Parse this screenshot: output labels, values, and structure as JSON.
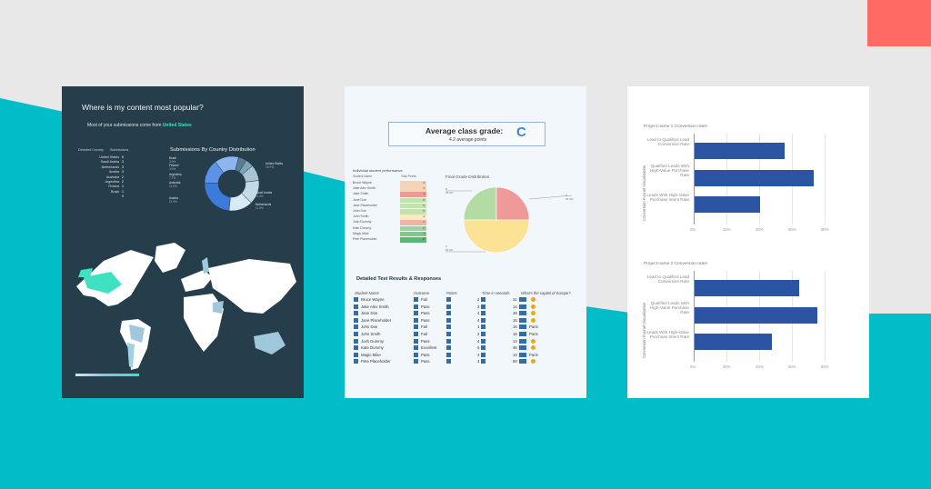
{
  "colors": {
    "teal": "#00bdc7",
    "coral": "#ff6b63",
    "navy": "#263d4b",
    "mint": "#45e0c5",
    "blue": "#2b54a3"
  },
  "panel1": {
    "title": "Where is my content most popular?",
    "subtitle_prefix": "Most of your submissions come from",
    "subtitle_country": "United States",
    "table_headers": [
      "Detected Country",
      "Submissions"
    ],
    "countries": [
      {
        "name": "United States",
        "count": "5"
      },
      {
        "name": "Saudi Arabia",
        "count": "3"
      },
      {
        "name": "Netherlands",
        "count": "3"
      },
      {
        "name": "Austria",
        "count": "3"
      },
      {
        "name": "Australia",
        "count": "2"
      },
      {
        "name": "Argentina",
        "count": "2"
      },
      {
        "name": "Finland",
        "count": "1"
      },
      {
        "name": "Brazil",
        "count": "1"
      },
      {
        "name": "",
        "count": "0"
      }
    ],
    "chart_title": "Submissions By Country Distribution",
    "donut_labels": [
      {
        "name": "Brazil",
        "pct": "3.9%"
      },
      {
        "name": "Finland",
        "pct": "3.9%"
      },
      {
        "name": "Argentina",
        "pct": "7.7%"
      },
      {
        "name": "Australia",
        "pct": "11.5%"
      },
      {
        "name": "Austria",
        "pct": "11.5%"
      },
      {
        "name": "United States",
        "pct": "19.2%"
      },
      {
        "name": "Saudi Arabia",
        "pct": "11.5%"
      },
      {
        "name": "Netherlands",
        "pct": "11.5%"
      }
    ]
  },
  "panel2": {
    "grade_title": "Average class grade:",
    "grade_sub": "4.2  average points",
    "grade_letter": "C",
    "individual_title": "Individual student performance",
    "ind_headers": [
      "Student Name",
      "Total Points"
    ],
    "students": [
      {
        "name": "Bruce Wayne",
        "points": "3",
        "color": "#f5d3b6"
      },
      {
        "name": "Jake Alex Smith",
        "points": "3",
        "color": "#f5d3b6"
      },
      {
        "name": "Jake Smith",
        "points": "1",
        "color": "#ee9a94"
      },
      {
        "name": "Jane Doe",
        "points": "5",
        "color": "#c3e2b0"
      },
      {
        "name": "Jane Placeholder",
        "points": "5",
        "color": "#c3e2b0"
      },
      {
        "name": "John Doe",
        "points": "5",
        "color": "#c3e2b0"
      },
      {
        "name": "John Smith",
        "points": "4",
        "color": "#fbe9c2"
      },
      {
        "name": "Josh Dummy",
        "points": "2",
        "color": "#f0b5a8"
      },
      {
        "name": "Kate Dummy",
        "points": "6",
        "color": "#9cd49a"
      },
      {
        "name": "Magic Mike",
        "points": "7",
        "color": "#7ec98a"
      },
      {
        "name": "Pete Placeholder",
        "points": "8",
        "color": "#5bb873"
      }
    ],
    "final_title": "Final Grade Distribution",
    "pie_labels": [
      {
        "label": "B",
        "pct": "25.0%"
      },
      {
        "label": "C",
        "pct": "50.0%"
      },
      {
        "label": "D",
        "pct": "25.0%"
      }
    ],
    "detailed_title": "Detailed Test Results & Responses",
    "detail_headers": [
      "Student Name",
      "Outcome",
      "Points",
      "Time in seconds",
      "What's the capital of Europe?"
    ],
    "results": [
      {
        "name": "Bruce Wayne",
        "outcome": "Fail",
        "points": "2",
        "time": "31",
        "answer": ""
      },
      {
        "name": "Jake Alex Smith",
        "outcome": "Pass",
        "points": "3",
        "time": "14",
        "answer": ""
      },
      {
        "name": "Jane Doe",
        "outcome": "Pass",
        "points": "4",
        "time": "49",
        "answer": ""
      },
      {
        "name": "Jane Placeholder",
        "outcome": "Pass",
        "points": "4",
        "time": "15",
        "answer": ""
      },
      {
        "name": "John Doe",
        "outcome": "Fail",
        "points": "1",
        "time": "16",
        "answer": "Paris"
      },
      {
        "name": "John Smith",
        "outcome": "Fail",
        "points": "2",
        "time": "15",
        "answer": "Paris"
      },
      {
        "name": "Josh Dummy",
        "outcome": "Pass",
        "points": "4",
        "time": "14",
        "answer": ""
      },
      {
        "name": "Kate Dummy",
        "outcome": "Excellent",
        "points": "5",
        "time": "46",
        "answer": ""
      },
      {
        "name": "Magic Mike",
        "outcome": "Pass",
        "points": "4",
        "time": "13",
        "answer": "Paris"
      },
      {
        "name": "Pete Placeholder",
        "outcome": "Pass",
        "points": "4",
        "time": "50",
        "answer": ""
      }
    ]
  },
  "panel3": {
    "y_axis_label": "Conversion Funnel Visualisation",
    "ticks": [
      "0%",
      "20%",
      "40%",
      "60%",
      "80%"
    ]
  },
  "chart_data": [
    {
      "type": "pie",
      "title": "Submissions By Country Distribution",
      "categories": [
        "Brazil",
        "Finland",
        "Argentina",
        "Australia",
        "Austria",
        "United States",
        "Saudi Arabia",
        "Netherlands"
      ],
      "values": [
        3.9,
        3.9,
        7.7,
        11.5,
        11.5,
        19.2,
        11.5,
        11.5
      ]
    },
    {
      "type": "pie",
      "title": "Final Grade Distribution",
      "categories": [
        "B",
        "C",
        "D"
      ],
      "values": [
        25.0,
        50.0,
        25.0
      ]
    },
    {
      "type": "bar",
      "orientation": "horizontal",
      "title": "Project name 1 Conversion rates",
      "ylabel": "Conversion Funnel Visualisation",
      "categories": [
        "Lead to Qualified Lead Conversion Rate",
        "Qualified Leads With High-Value Purchase Rate",
        "Leads With High-Value Purchase Intent Rate"
      ],
      "values": [
        55,
        73,
        40
      ],
      "xlim": [
        0,
        80
      ]
    },
    {
      "type": "bar",
      "orientation": "horizontal",
      "title": "Project name 2 Conversion rates",
      "ylabel": "Conversion Funnel Visualisation",
      "categories": [
        "Lead to Qualified Lead Conversion Rate",
        "Qualified Leads With High-Value Purchase Rate",
        "Leads With High-Value Purchase Intent Rate"
      ],
      "values": [
        64,
        75,
        47
      ],
      "xlim": [
        0,
        80
      ]
    }
  ]
}
